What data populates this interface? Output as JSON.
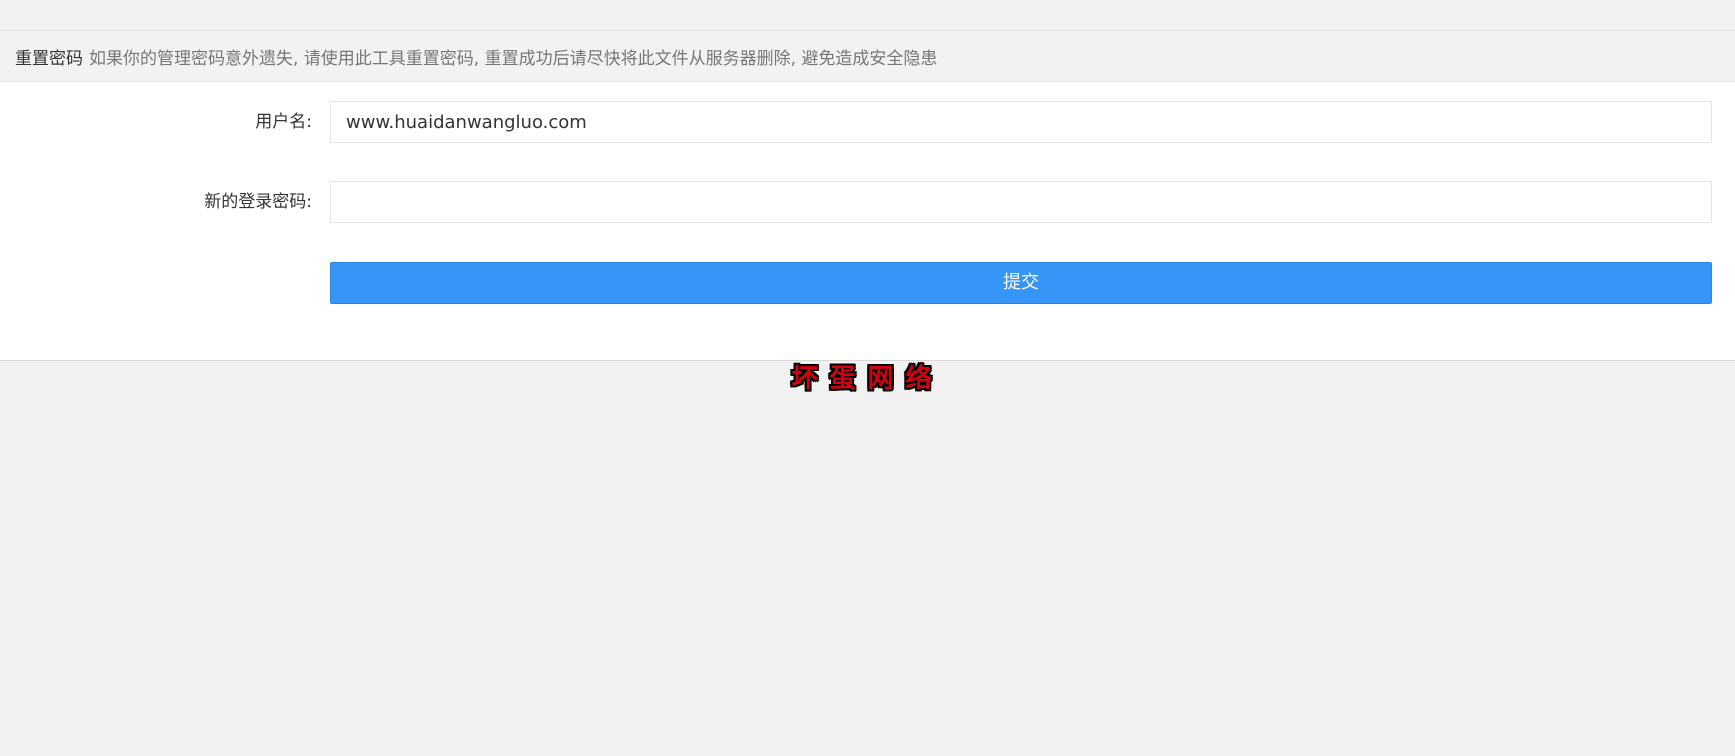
{
  "header": {
    "title": "重置密码",
    "tip": "如果你的管理密码意外遗失, 请使用此工具重置密码, 重置成功后请尽快将此文件从服务器删除, 避免造成安全隐患"
  },
  "form": {
    "username": {
      "label": "用户名:",
      "value": "www.huaidanwangluo.com"
    },
    "password": {
      "label": "新的登录密码:",
      "value": ""
    },
    "submit_label": "提交"
  },
  "footer": {
    "mark": "坏蛋网络"
  },
  "colors": {
    "primary": "#3596f8",
    "mark": "#d4000f"
  }
}
